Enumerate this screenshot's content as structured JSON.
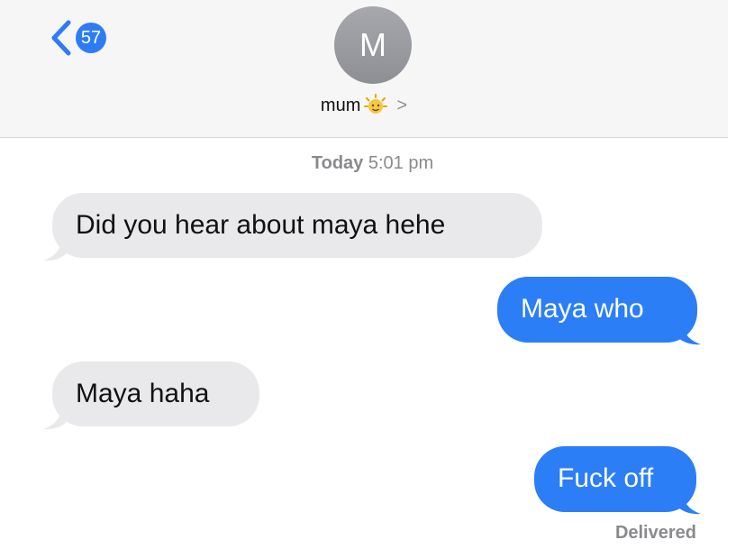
{
  "header": {
    "back_badge": "57",
    "avatar_initial": "M",
    "contact_name": "mum",
    "contact_emoji": "sparkle-face-icon",
    "chevron": ">"
  },
  "thread": {
    "timestamp_day": "Today",
    "timestamp_time": "5:01 pm",
    "messages": [
      {
        "direction": "incoming",
        "text": "Did you hear about maya hehe"
      },
      {
        "direction": "outgoing",
        "text": "Maya who"
      },
      {
        "direction": "incoming",
        "text": "Maya haha"
      },
      {
        "direction": "outgoing",
        "text": "Fuck off"
      }
    ],
    "status": "Delivered"
  },
  "colors": {
    "outgoing_bubble": "#2b7ef6",
    "incoming_bubble": "#e9e9eb",
    "header_bg": "#f6f6f7"
  }
}
